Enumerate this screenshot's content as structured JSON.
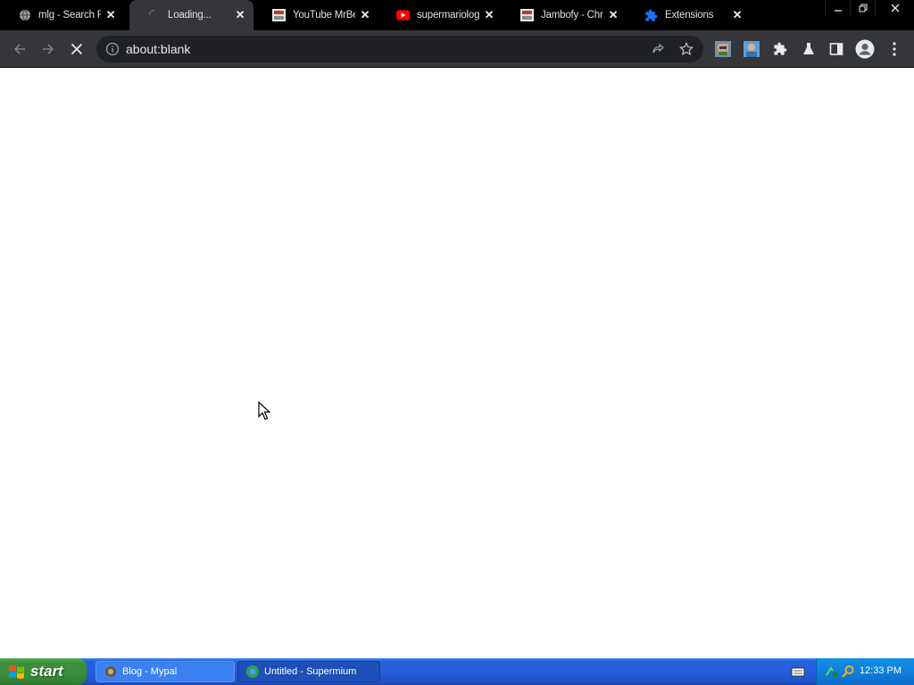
{
  "browser": {
    "tabs": [
      {
        "title": "mlg - Search R",
        "icon": "globe-icon",
        "active": false
      },
      {
        "title": "Loading...",
        "icon": "loading-spinner-icon",
        "active": true
      },
      {
        "title": "YouTube MrBe",
        "icon": "page-thumbnail-icon",
        "active": false
      },
      {
        "title": "supermariolog",
        "icon": "youtube-icon",
        "active": false
      },
      {
        "title": "Jambofy - Chr",
        "icon": "page-thumbnail-icon",
        "active": false
      },
      {
        "title": "Extensions",
        "icon": "puzzle-icon",
        "active": false
      }
    ],
    "address": "about:blank",
    "colors": {
      "tabstrip": "#000000",
      "toolbar": "#35363a",
      "omnibox": "#202124",
      "text": "#e8eaed"
    }
  },
  "taskbar": {
    "start_label": "start",
    "windows": [
      {
        "label": "Blog - Mypal",
        "active": false
      },
      {
        "label": "Untitled - Supermium",
        "active": true
      }
    ],
    "clock": "12:33 PM"
  }
}
